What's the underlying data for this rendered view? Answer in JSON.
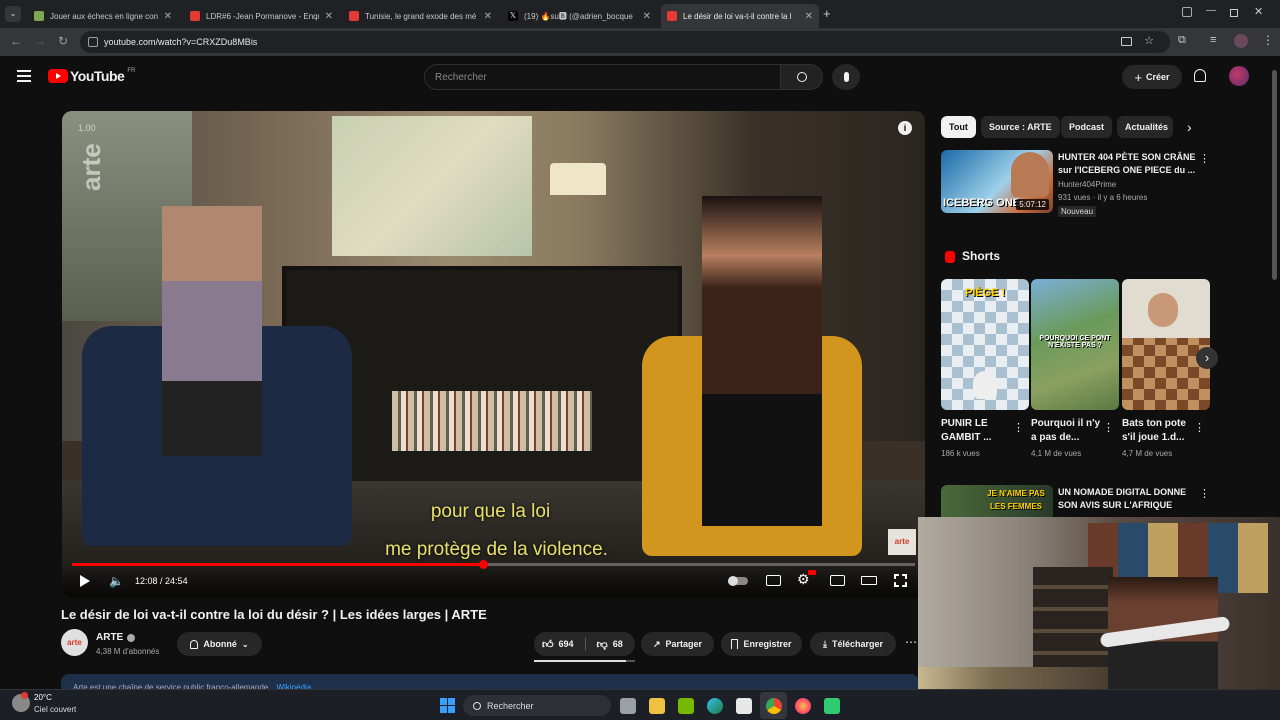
{
  "browser": {
    "tabs": [
      {
        "title": "Jouer aux échecs en ligne contr",
        "color": "#7fa650"
      },
      {
        "title": "LDR#6 -Jean Pormanove - Enqu",
        "color": "#e53935"
      },
      {
        "title": "Tunisie, le grand exode des mé",
        "color": "#e53935"
      },
      {
        "title": "(19) 🔥su🅱 (@adrien_bocque",
        "color": "#000000"
      },
      {
        "title": "Le désir de loi va-t-il contre la l",
        "color": "#e53935"
      }
    ],
    "url": "youtube.com/watch?v=CRXZDu8MBis"
  },
  "youtube": {
    "logo_text": "YouTube",
    "region": "FR",
    "search_placeholder": "Rechercher",
    "create_label": "Créer"
  },
  "player": {
    "watermark": "arte",
    "speed_label": "1.00",
    "subtitle_line1": "pour que la loi",
    "subtitle_line2": "me protège de la violence.",
    "time_current": "12:08",
    "time_sep": " / ",
    "time_total": "24:54",
    "progress": 0.487,
    "corner_badge": "arte"
  },
  "video": {
    "title": "Le désir de loi va-t-il contre la loi du désir ? | Les idées larges | ARTE",
    "channel_name": "ARTE",
    "channel_avatar_text": "arte",
    "subscribers": "4,38 M d'abonnés",
    "subscribed_label": "Abonné",
    "likes": "694",
    "dislikes": "68",
    "share_label": "Partager",
    "save_label": "Enregistrer",
    "download_label": "Télécharger",
    "description_line": "Arte est une chaîne de service public franco-allemande",
    "wikipedia_label": "Wikipédia"
  },
  "sidebar": {
    "chips": [
      "Tout",
      "Source : ARTE",
      "Podcast",
      "Actualités"
    ],
    "recommended": {
      "title_line1": "HUNTER 404 PÈTE SON CRÂNE",
      "title_line2": "sur l'ICEBERG ONE PIECE du ...",
      "channel": "Hunter404Prime",
      "meta": "931 vues · il y a 6 heures",
      "badge": "Nouveau",
      "duration": "5:07:12",
      "thumb_text": "ICEBERG ONE"
    },
    "shorts_heading": "Shorts",
    "shorts": [
      {
        "title": "PUNIR LE GAMBIT ...",
        "views": "186 k vues",
        "overlay": "PIÈGE !"
      },
      {
        "title": "Pourquoi il n'y a pas de...",
        "views": "4,1 M de vues",
        "overlay": "POURQUOI CE PONT N'EXISTE PAS ?"
      },
      {
        "title": "Bats ton pote s'il joue 1.d...",
        "views": "4,7 M de vues",
        "overlay": ""
      }
    ],
    "next": {
      "title_line1": "UN NOMADE DIGITAL DONNE",
      "title_line2": "SON AVIS SUR L'AFRIQUE",
      "thumb_text": "JE N'AIME PAS LES FEMMES"
    }
  },
  "taskbar": {
    "weather_temp": "20°C",
    "weather_desc": "Ciel couvert",
    "search_label": "Rechercher"
  }
}
